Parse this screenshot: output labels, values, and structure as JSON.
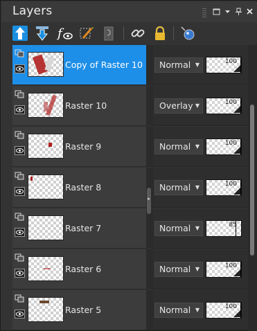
{
  "panel": {
    "title": "Layers",
    "title_buttons": [
      "restore-icon",
      "dropdown-arrow-icon",
      "pin-icon",
      "close-icon"
    ],
    "toolbar": [
      "move-layer-up-icon",
      "move-layer-down-icon",
      "visibility-eye-icon",
      "edit-selection-icon",
      "lock-transparency-icon",
      "link-icon",
      "lock-icon",
      "mask-icon"
    ]
  },
  "layers": [
    {
      "name": "Copy of Raster 10",
      "blend": "Normal",
      "opacity": "100",
      "selected": true
    },
    {
      "name": "Raster 10",
      "blend": "Overlay",
      "opacity": "100",
      "selected": false
    },
    {
      "name": "Raster 9",
      "blend": "Normal",
      "opacity": "100",
      "selected": false
    },
    {
      "name": "Raster 8",
      "blend": "Normal",
      "opacity": "100",
      "selected": false
    },
    {
      "name": "Raster 7",
      "blend": "Normal",
      "opacity": "85",
      "selected": false
    },
    {
      "name": "Raster 6",
      "blend": "Normal",
      "opacity": "100",
      "selected": false
    },
    {
      "name": "Raster 5",
      "blend": "Normal",
      "opacity": "100",
      "selected": false
    }
  ],
  "colors": {
    "selected": "#1e8fe8",
    "thumb_art": "#b02020"
  }
}
